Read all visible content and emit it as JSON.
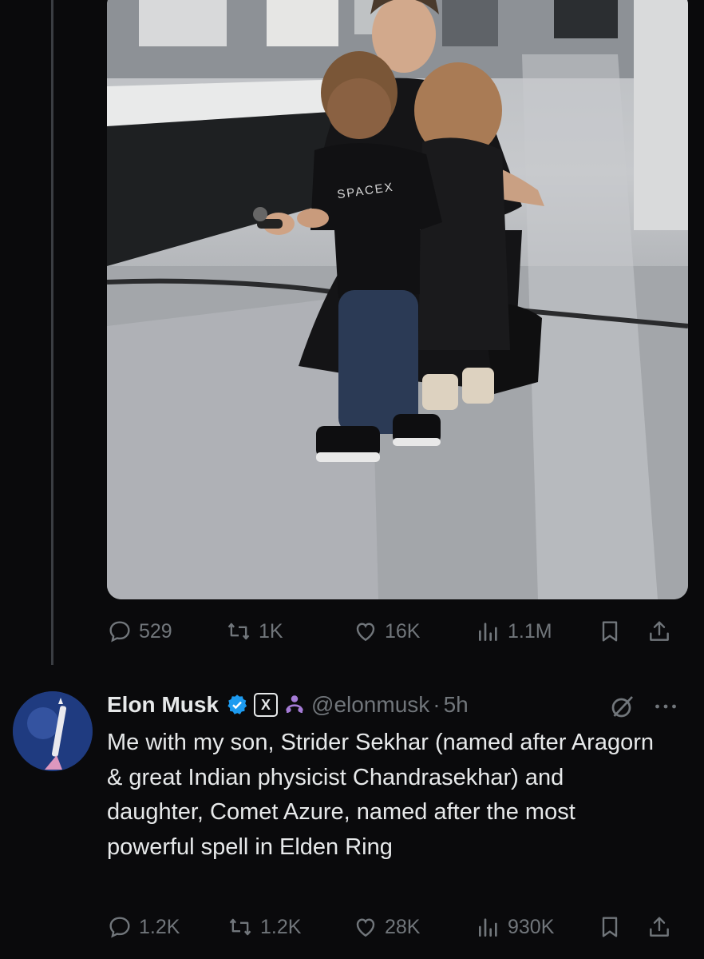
{
  "parent_tweet": {
    "media": {
      "shirt_text": "SPACEX"
    },
    "actions": {
      "replies": "529",
      "reposts": "1K",
      "likes": "16K",
      "views": "1.1M"
    }
  },
  "tweet": {
    "author_name": "Elon Musk",
    "badges": [
      "verified-badge",
      "x-affiliate-badge",
      "organization-badge"
    ],
    "affiliate_label": "X",
    "handle": "@elonmusk",
    "separator": "·",
    "time": "5h",
    "text": "Me with my son, Strider Sekhar (named after Aragorn & great Indian physicist Chandrasekhar) and daughter, Comet Azure, named after the most powerful spell in Elden Ring",
    "actions": {
      "replies": "1.2K",
      "reposts": "1.2K",
      "likes": "28K",
      "views": "930K"
    }
  },
  "colors": {
    "background": "#0a0a0c",
    "text_primary": "#e7e9ea",
    "text_secondary": "#71767b",
    "verified_blue": "#1d9bf0",
    "organization_purple": "#a57bd6"
  },
  "icons": [
    "reply-icon",
    "repost-icon",
    "like-icon",
    "views-icon",
    "bookmark-icon",
    "share-icon",
    "grok-icon",
    "more-icon"
  ]
}
